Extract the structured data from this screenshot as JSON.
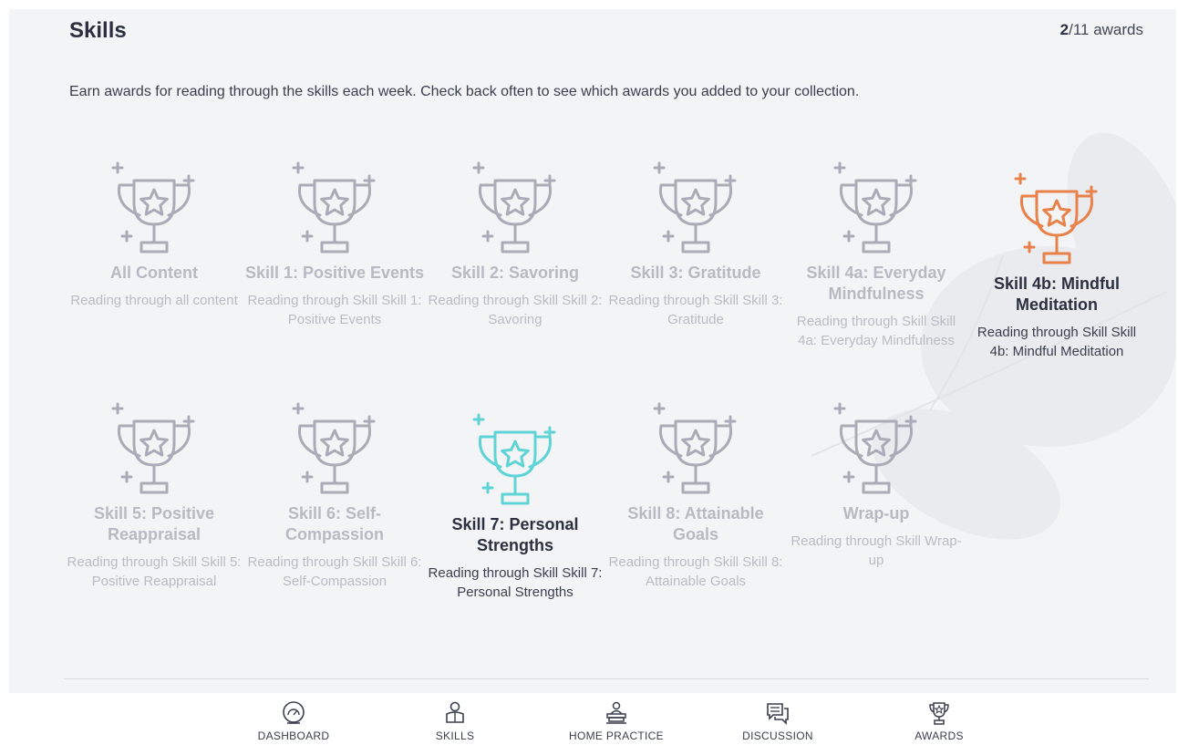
{
  "header": {
    "title": "Skills",
    "count_earned": "2",
    "count_rest": "/11 awards"
  },
  "intro": "Earn awards for reading through the skills each week. Check back often to see which awards you added to your collection.",
  "colors": {
    "locked": "#a9acb7",
    "orange": "#e8824a",
    "teal": "#5fd3d6"
  },
  "awards": [
    {
      "name": "All Content",
      "desc": "Reading through all content",
      "state": "locked",
      "color": "#a9acb7",
      "icon": "trophy-icon"
    },
    {
      "name": "Skill 1: Positive Events",
      "desc": "Reading through Skill Skill 1: Positive Events",
      "state": "locked",
      "color": "#a9acb7",
      "icon": "trophy-icon"
    },
    {
      "name": "Skill 2: Savoring",
      "desc": "Reading through Skill Skill 2: Savoring",
      "state": "locked",
      "color": "#a9acb7",
      "icon": "trophy-icon"
    },
    {
      "name": "Skill 3: Gratitude",
      "desc": "Reading through Skill Skill 3: Gratitude",
      "state": "locked",
      "color": "#a9acb7",
      "icon": "trophy-icon"
    },
    {
      "name": "Skill 4a: Everyday Mindfulness",
      "desc": "Reading through Skill Skill 4a: Everyday Mindfulness",
      "state": "locked",
      "color": "#a9acb7",
      "icon": "trophy-icon"
    },
    {
      "name": "Skill 4b: Mindful Meditation",
      "desc": "Reading through Skill Skill 4b: Mindful Meditation",
      "state": "earned",
      "color": "#e8824a",
      "icon": "trophy-icon"
    },
    {
      "name": "Skill 5: Positive Reappraisal",
      "desc": "Reading through Skill Skill 5: Positive Reappraisal",
      "state": "locked",
      "color": "#a9acb7",
      "icon": "trophy-icon"
    },
    {
      "name": "Skill 6: Self-Compassion",
      "desc": "Reading through Skill Skill 6: Self-Compassion",
      "state": "locked",
      "color": "#a9acb7",
      "icon": "trophy-icon"
    },
    {
      "name": "Skill 7: Personal Strengths",
      "desc": "Reading through Skill Skill 7: Personal Strengths",
      "state": "earned",
      "color": "#5fd3d6",
      "icon": "trophy-icon"
    },
    {
      "name": "Skill 8: Attainable Goals",
      "desc": "Reading through Skill Skill 8: Attainable Goals",
      "state": "locked",
      "color": "#a9acb7",
      "icon": "trophy-icon"
    },
    {
      "name": "Wrap-up",
      "desc": "Reading through Skill Wrap-up",
      "state": "locked",
      "color": "#a9acb7",
      "icon": "trophy-icon"
    }
  ],
  "nav": [
    {
      "label": "DASHBOARD",
      "icon": "dashboard-gauge-icon"
    },
    {
      "label": "SKILLS",
      "icon": "skills-person-icon"
    },
    {
      "label": "HOME PRACTICE",
      "icon": "home-practice-icon"
    },
    {
      "label": "DISCUSSION",
      "icon": "discussion-icon"
    },
    {
      "label": "AWARDS",
      "icon": "awards-trophy-icon"
    }
  ]
}
